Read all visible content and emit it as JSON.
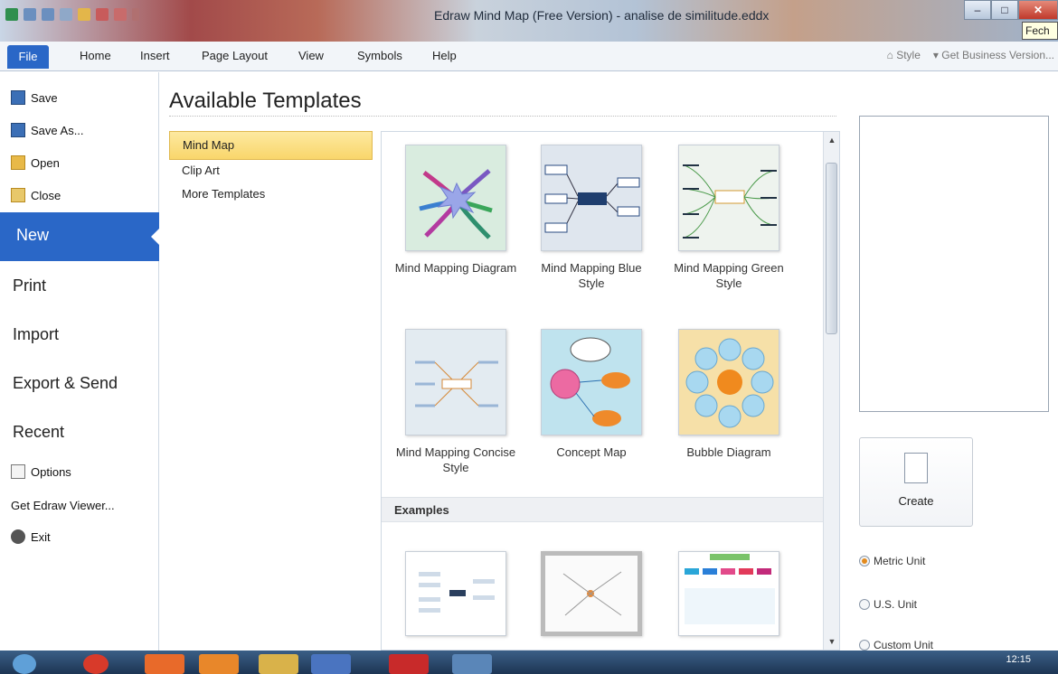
{
  "window": {
    "title": "Edraw Mind Map (Free Version) - analise de similitude.eddx",
    "tooltip": "Fech"
  },
  "ribbon": {
    "tabs": [
      "File",
      "Home",
      "Insert",
      "Page Layout",
      "View",
      "Symbols",
      "Help"
    ],
    "right": {
      "style": "Style",
      "business": "Get Business Version..."
    }
  },
  "backstage": {
    "save": "Save",
    "save_as": "Save As...",
    "open": "Open",
    "close": "Close",
    "new": "New",
    "print": "Print",
    "import": "Import",
    "export": "Export & Send",
    "recent": "Recent",
    "options": "Options",
    "viewer": "Get Edraw Viewer...",
    "exit": "Exit"
  },
  "main": {
    "heading": "Available Templates",
    "categories": [
      "Mind Map",
      "Clip Art",
      "More Templates"
    ],
    "templates": [
      {
        "name": "Mind Mapping Diagram"
      },
      {
        "name": "Mind Mapping Blue Style"
      },
      {
        "name": "Mind Mapping Green Style"
      },
      {
        "name": "Mind Mapping Concise Style"
      },
      {
        "name": "Concept Map"
      },
      {
        "name": "Bubble Diagram"
      }
    ],
    "examples_header": "Examples"
  },
  "right_panel": {
    "create": "Create",
    "units": [
      "Metric Unit",
      "U.S. Unit",
      "Custom Unit"
    ],
    "selected_unit": "Metric Unit"
  },
  "taskbar": {
    "clock": "12:15"
  },
  "colors": {
    "accent": "#2a67c7",
    "selection": "#f9d66b"
  }
}
